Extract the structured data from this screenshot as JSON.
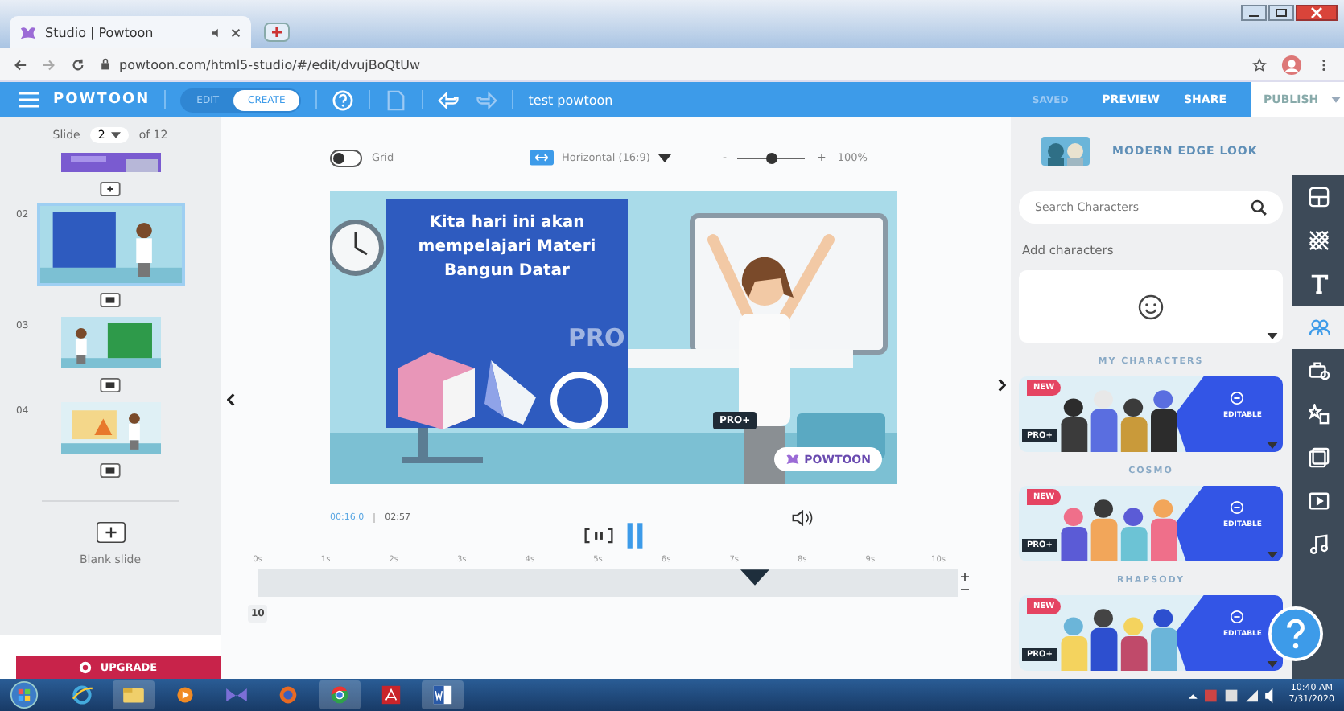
{
  "browser": {
    "tab_title": "Studio | Powtoon",
    "url": "powtoon.com/html5-studio/#/edit/dvujBoQtUw"
  },
  "toolbar": {
    "logo": "POWTOON",
    "modes": [
      {
        "label": "EDIT",
        "selected": false
      },
      {
        "label": "CREATE",
        "selected": true
      }
    ],
    "title": "test powtoon",
    "status": "SAVED",
    "actions": [
      "PREVIEW",
      "SHARE"
    ],
    "publish": "PUBLISH"
  },
  "slides_panel": {
    "label": "Slide",
    "current": "2",
    "total": "of 12",
    "slides": [
      {
        "number": "02",
        "selected": true
      },
      {
        "number": "03",
        "selected": false
      },
      {
        "number": "04",
        "selected": false
      }
    ],
    "blank": "Blank slide",
    "upgrade": "UPGRADE"
  },
  "stage": {
    "grid": {
      "label": "Grid",
      "on": false
    },
    "format": "Horizontal (16:9)",
    "zoom": {
      "minus": "-",
      "plus": "+",
      "level": 0.5,
      "reading": "100%"
    },
    "slide_text": "Kita hari ini akan mempelajari Materi Bangun Datar",
    "watermark": "PRO",
    "badge": "PRO+",
    "brand": "POWTOON",
    "time": "00:16.0",
    "duration": "02:57",
    "timeline": {
      "ticks": [
        "0s",
        "1s",
        "2s",
        "3s",
        "4s",
        "5s",
        "6s",
        "7s",
        "8s",
        "9s",
        "10s"
      ],
      "level": 0.71,
      "zoom": "10"
    }
  },
  "characters": {
    "style": "MODERN EDGE LOOK",
    "search": {
      "placeholder": "Search Characters"
    },
    "add": "Add characters",
    "groups": [
      {
        "title": "MY CHARACTERS",
        "new": "NEW",
        "pro": "PRO+",
        "editable": "EDITABLE"
      },
      {
        "title": "COSMO",
        "new": "NEW",
        "pro": "PRO+",
        "editable": "EDITABLE"
      },
      {
        "title": "RHAPSODY",
        "new": "NEW",
        "pro": "PRO+",
        "editable": "EDITABLE"
      }
    ]
  },
  "rail": [
    {
      "selected": false
    },
    {
      "selected": false
    },
    {
      "selected": false
    },
    {
      "selected": true
    },
    {
      "selected": false
    },
    {
      "selected": false
    },
    {
      "selected": false
    },
    {
      "selected": false
    },
    {
      "selected": false
    }
  ],
  "taskbar": {
    "time": "10:40 AM",
    "date": "7/31/2020"
  }
}
